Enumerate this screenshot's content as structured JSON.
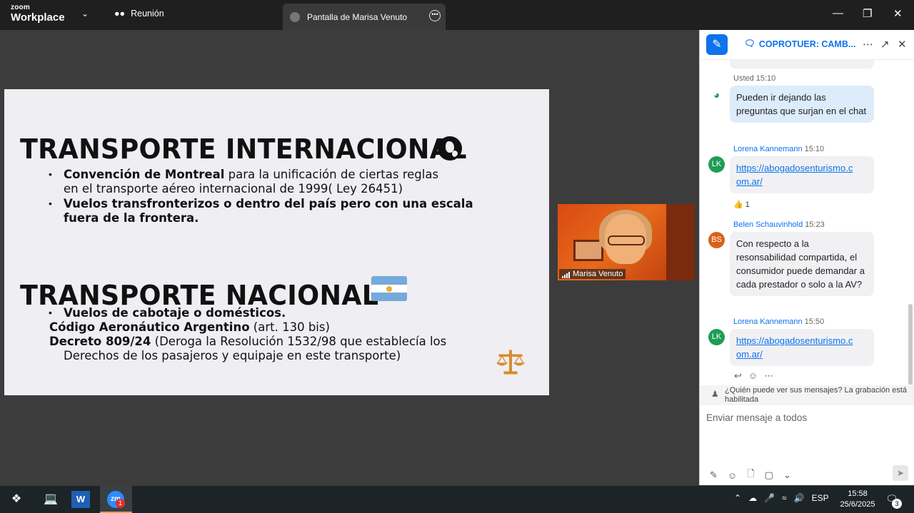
{
  "topbar": {
    "brand_small": "zoom",
    "brand_big": "Workplace",
    "meeting_label": "Reunión",
    "share_tab_label": "Pantalla de Marisa Venuto"
  },
  "slide": {
    "heading1": "TRANSPORTE INTERNACIONAL",
    "b1_bold": "Convención de Montreal",
    "b1_rest": " para la unificación de ciertas reglas",
    "b1_line2": "en el transporte aéreo internacional de 1999( Ley 26451)",
    "b2_line1": "Vuelos transfronterizos o dentro del país pero con una escala",
    "b2_line2": "fuera de la frontera.",
    "heading2": "TRANSPORTE NACIONAL",
    "n1": "Vuelos de cabotaje o domésticos.",
    "n2_bold": "Código Aeronáutico Argentino",
    "n2_rest": " (art. 130 bis)",
    "n3_bold": "Decreto 809/24",
    "n3_rest": " (Deroga la Resolución 1532/98 que establecía los",
    "n3_line2": "Derechos de los pasajeros y equipaje en este transporte)"
  },
  "video": {
    "name": "Marisa Venuto"
  },
  "chat": {
    "title": "COPROTUER: CAMB...",
    "messages": [
      {
        "sender": "Usted",
        "time": "15:10",
        "text": "Pueden ir dejando las preguntas que surjan en el chat"
      },
      {
        "sender": "Lorena Kannemann",
        "time": "15:10",
        "initials": "LK",
        "link": "https://abogadosenturismo.com.ar/",
        "link_l1": "https://abogadosenturismo.c",
        "link_l2": "om.ar/"
      },
      {
        "sender": "Belen Schauvinhold",
        "time": "15:23",
        "initials": "BS",
        "text": "Con respecto a la resonsabilidad compartida, el consumidor puede demandar a cada prestador o solo a la AV?"
      },
      {
        "sender": "Lorena Kannemann",
        "time": "15:50",
        "initials": "LK",
        "link_l1": "https://abogadosenturismo.c",
        "link_l2": "om.ar/"
      }
    ],
    "reaction_count": "1",
    "privacy_notice": "¿Quién puede ver sus mensajes? La grabación está habilitada",
    "input_placeholder": "Enviar mensaje a todos"
  },
  "taskbar": {
    "language": "ESP",
    "time": "15:58",
    "date": "25/6/2025",
    "zoom_badge": "1",
    "notification_count": "3"
  },
  "colors": {
    "accent": "#0e72ed",
    "lk_avatar": "#1f9d55",
    "bs_avatar": "#d9621b"
  }
}
